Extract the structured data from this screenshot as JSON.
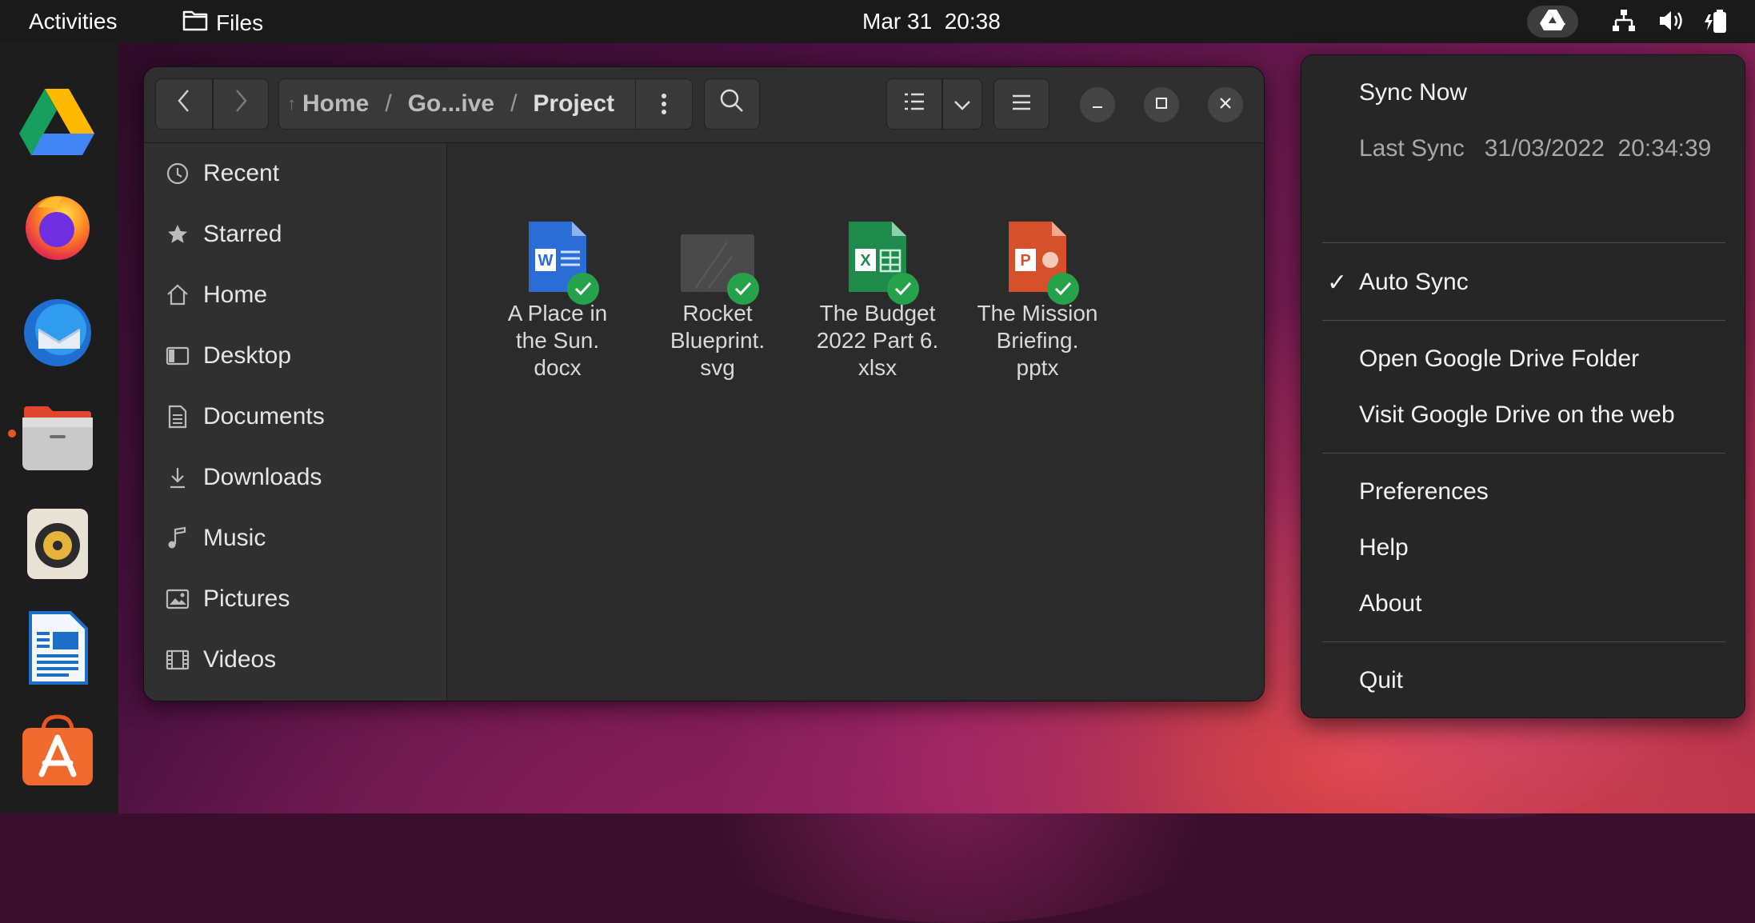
{
  "topbar": {
    "activities": "Activities",
    "app_name": "Files",
    "clock_date": "Mar 31",
    "clock_time": "20:38"
  },
  "dock": {
    "items": [
      "google-drive-icon",
      "firefox-icon",
      "thunderbird-icon",
      "files-icon",
      "rhythmbox-icon",
      "libreoffice-writer-icon",
      "software-center-icon"
    ]
  },
  "files_window": {
    "path": [
      "Home",
      "Go...ive",
      "Project"
    ],
    "sidebar": [
      {
        "label": "Recent",
        "icon": "clock-icon"
      },
      {
        "label": "Starred",
        "icon": "star-icon"
      },
      {
        "label": "Home",
        "icon": "home-icon"
      },
      {
        "label": "Desktop",
        "icon": "desktop-icon"
      },
      {
        "label": "Documents",
        "icon": "document-icon"
      },
      {
        "label": "Downloads",
        "icon": "download-icon"
      },
      {
        "label": "Music",
        "icon": "music-icon"
      },
      {
        "label": "Pictures",
        "icon": "pictures-icon"
      },
      {
        "label": "Videos",
        "icon": "video-icon"
      }
    ],
    "files": [
      {
        "line1": "A Place in",
        "line2": "the Sun.",
        "line3": "docx",
        "type": "word",
        "letter": "W",
        "color": "#2b6dd6"
      },
      {
        "line1": "Rocket",
        "line2": "Blueprint.",
        "line3": "svg",
        "type": "svg",
        "letter": "",
        "color": "#4a4a4a"
      },
      {
        "line1": "The Budget",
        "line2": "2022 Part 6.",
        "line3": "xlsx",
        "type": "excel",
        "letter": "X",
        "color": "#1e8a4c"
      },
      {
        "line1": "The Mission",
        "line2": "Briefing.",
        "line3": "pptx",
        "type": "powerpoint",
        "letter": "P",
        "color": "#d6502b"
      }
    ]
  },
  "drive_menu": {
    "sync_now": "Sync Now",
    "last_sync": "Last Sync   31/03/2022  20:34:39",
    "auto_sync_check": "✓",
    "auto_sync": "Auto Sync",
    "open_folder": "Open Google Drive Folder",
    "visit_web": "Visit Google Drive on the web",
    "preferences": "Preferences",
    "help": "Help",
    "about": "About",
    "quit": "Quit"
  }
}
